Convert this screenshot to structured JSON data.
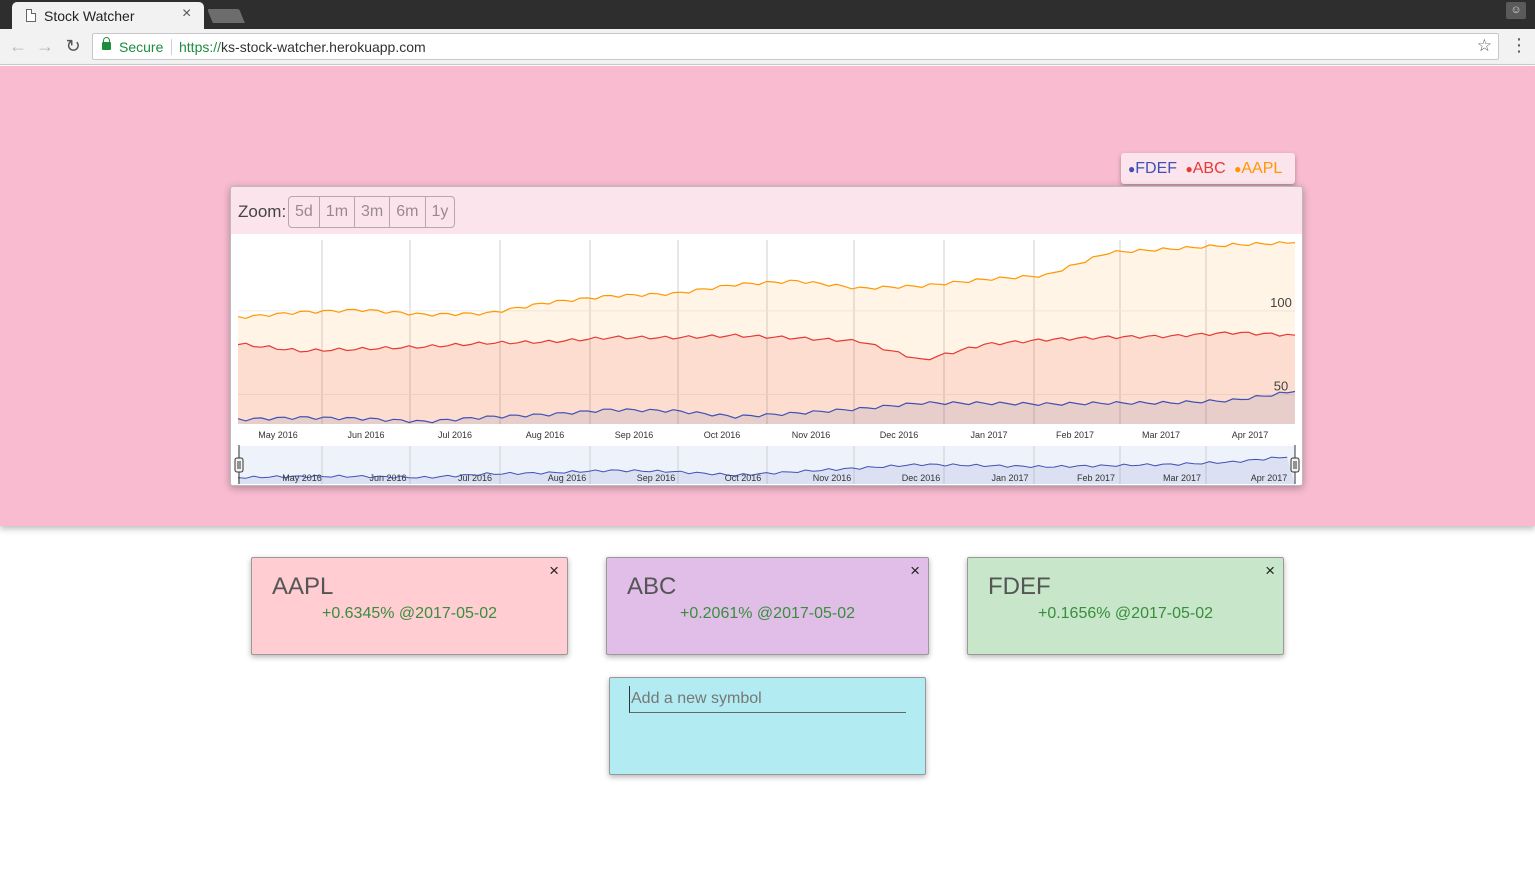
{
  "browser": {
    "tab_title": "Stock Watcher",
    "tab_close": "×",
    "secure_label": "Secure",
    "url_protocol": "https://",
    "url_host": "ks-stock-watcher.herokuapp.com"
  },
  "legend": [
    {
      "symbol": "FDEF",
      "color": "#3f51b5"
    },
    {
      "symbol": "ABC",
      "color": "#e53935"
    },
    {
      "symbol": "AAPL",
      "color": "#ff9800"
    }
  ],
  "zoom": {
    "label": "Zoom:",
    "buttons": [
      "5d",
      "1m",
      "3m",
      "6m",
      "1y"
    ]
  },
  "chart_data": {
    "type": "area",
    "x_axis_labels": [
      "May 2016",
      "Jun 2016",
      "Jul 2016",
      "Aug 2016",
      "Sep 2016",
      "Oct 2016",
      "Nov 2016",
      "Dec 2016",
      "Jan 2017",
      "Feb 2017",
      "Mar 2017",
      "Apr 2017"
    ],
    "y_ticks": [
      50,
      100
    ],
    "ylim": [
      30,
      140
    ],
    "x_range": [
      "2016-05",
      "2017-05"
    ],
    "grid": "vertical",
    "series": [
      {
        "name": "AAPL",
        "color": "#ff9800",
        "values": [
          93,
          96,
          98,
          96,
          97,
          103,
          106,
          107,
          113,
          116,
          112,
          113,
          116,
          118,
          132,
          135,
          138,
          139
        ]
      },
      {
        "name": "ABC",
        "color": "#e53935",
        "values": [
          78,
          73,
          74,
          76,
          79,
          80,
          82,
          81,
          82,
          81,
          80,
          69,
          78,
          80,
          81,
          82,
          85,
          84
        ]
      },
      {
        "name": "FDEF",
        "color": "#3f51b5",
        "values": [
          32,
          33,
          33,
          32,
          35,
          36,
          38,
          37,
          34,
          37,
          40,
          43,
          42,
          41,
          42,
          43,
          45,
          50
        ]
      }
    ]
  },
  "stocks": [
    {
      "symbol": "AAPL",
      "change": "+0.6345% @2017-05-02",
      "close": "×",
      "bg": "#ffcdd2"
    },
    {
      "symbol": "ABC",
      "change": "+0.2061% @2017-05-02",
      "close": "×",
      "bg": "#e1bee7"
    },
    {
      "symbol": "FDEF",
      "change": "+0.1656% @2017-05-02",
      "close": "×",
      "bg": "#c8e6c9"
    }
  ],
  "add_symbol": {
    "placeholder": "Add a new symbol"
  }
}
